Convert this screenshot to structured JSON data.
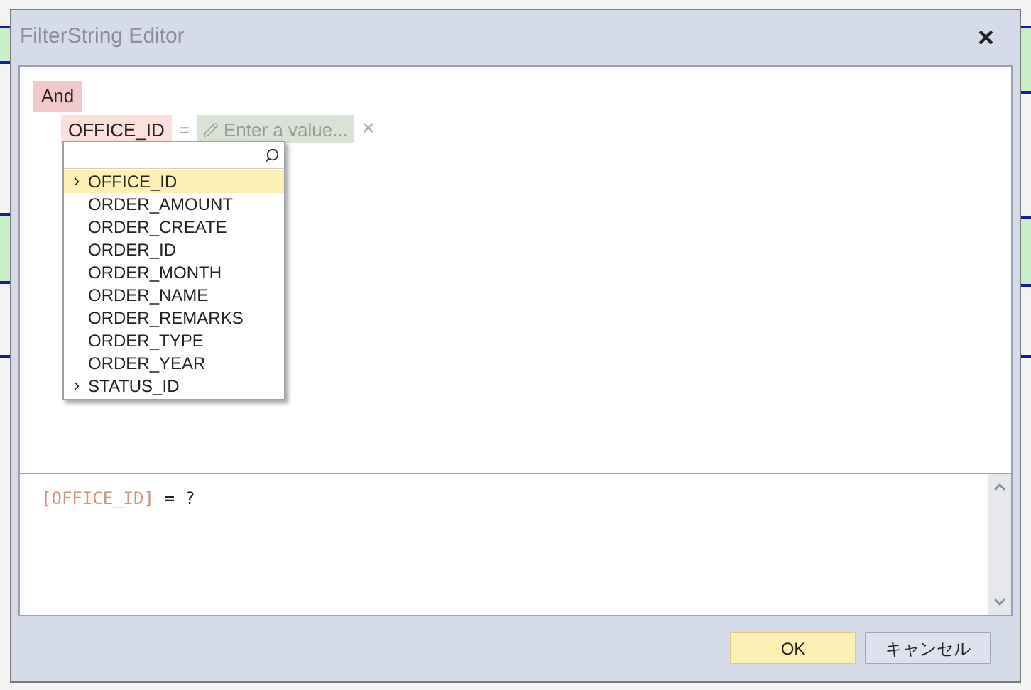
{
  "window": {
    "title": "FilterString Editor",
    "close": "×"
  },
  "group": {
    "operator": "And"
  },
  "condition": {
    "field": "OFFICE_ID",
    "operator": "=",
    "value_placeholder": "Enter a value...",
    "remove": "×"
  },
  "field_picker": {
    "items": [
      {
        "label": "OFFICE_ID",
        "expandable": true,
        "selected": true
      },
      {
        "label": "ORDER_AMOUNT",
        "expandable": false,
        "selected": false
      },
      {
        "label": "ORDER_CREATE",
        "expandable": false,
        "selected": false
      },
      {
        "label": "ORDER_ID",
        "expandable": false,
        "selected": false
      },
      {
        "label": "ORDER_MONTH",
        "expandable": false,
        "selected": false
      },
      {
        "label": "ORDER_NAME",
        "expandable": false,
        "selected": false
      },
      {
        "label": "ORDER_REMARKS",
        "expandable": false,
        "selected": false
      },
      {
        "label": "ORDER_TYPE",
        "expandable": false,
        "selected": false
      },
      {
        "label": "ORDER_YEAR",
        "expandable": false,
        "selected": false
      },
      {
        "label": "STATUS_ID",
        "expandable": true,
        "selected": false
      }
    ]
  },
  "expression": {
    "parts": [
      {
        "kind": "field",
        "text": "[OFFICE_ID]"
      },
      {
        "kind": "text",
        "text": " = ?"
      }
    ]
  },
  "buttons": [
    {
      "label": "OK",
      "default": true
    },
    {
      "label": "キャンセル",
      "default": false
    }
  ]
}
